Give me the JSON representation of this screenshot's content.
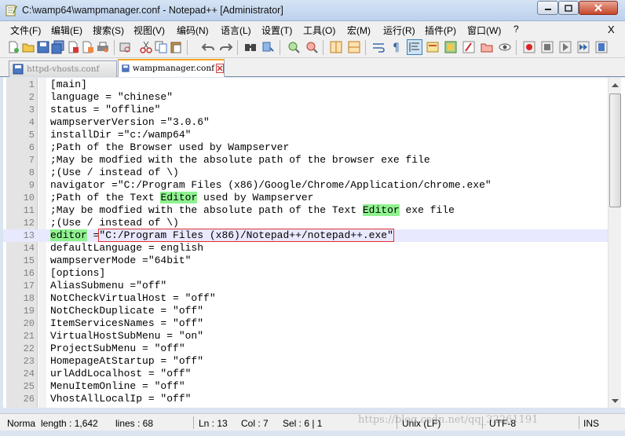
{
  "window": {
    "title": "C:\\wamp64\\wampmanager.conf - Notepad++ [Administrator]"
  },
  "menu": {
    "items": [
      "文件(F)",
      "编辑(E)",
      "搜索(S)",
      "视图(V)",
      "编码(N)",
      "语言(L)",
      "设置(T)",
      "工具(O)",
      "宏(M)",
      "运行(R)",
      "插件(P)",
      "窗口(W)",
      "?"
    ],
    "close_label": "X"
  },
  "tabs": [
    {
      "label": "httpd-vhosts.conf",
      "active": false
    },
    {
      "label": "wampmanager.conf",
      "active": true
    }
  ],
  "editor": {
    "lines": [
      {
        "n": "1",
        "text": "[main]"
      },
      {
        "n": "2",
        "text": "language = \"chinese\""
      },
      {
        "n": "3",
        "text": "status = \"offline\""
      },
      {
        "n": "4",
        "text": "wampserverVersion =\"3.0.6\""
      },
      {
        "n": "5",
        "text": "installDir =\"c:/wamp64\""
      },
      {
        "n": "6",
        "text": ";Path of the Browser used by Wampserver"
      },
      {
        "n": "7",
        "text": ";May be modfied with the absolute path of the browser exe file"
      },
      {
        "n": "8",
        "text": ";(Use / instead of \\)"
      },
      {
        "n": "9",
        "text": "navigator =\"C:/Program Files (x86)/Google/Chrome/Application/chrome.exe\""
      },
      {
        "n": "10",
        "pre": ";Path of the Text ",
        "hl": "Editor",
        "post": " used by Wampserver"
      },
      {
        "n": "11",
        "pre": ";May be modfied with the absolute path of the Text ",
        "hl": "Editor",
        "post": " exe file"
      },
      {
        "n": "12",
        "text": ";(Use / instead of \\)"
      },
      {
        "n": "13",
        "hl": "editor",
        "mid": " =",
        "boxed": "\"C:/Program Files (x86)/Notepad++/notepad++.exe\"",
        "current": true
      },
      {
        "n": "14",
        "text": "defaultLanguage = english"
      },
      {
        "n": "15",
        "text": "wampserverMode =\"64bit\""
      },
      {
        "n": "16",
        "text": "[options]"
      },
      {
        "n": "17",
        "text": "AliasSubmenu =\"off\""
      },
      {
        "n": "18",
        "text": "NotCheckVirtualHost = \"off\""
      },
      {
        "n": "19",
        "text": "NotCheckDuplicate = \"off\""
      },
      {
        "n": "20",
        "text": "ItemServicesNames = \"off\""
      },
      {
        "n": "21",
        "text": "VirtualHostSubMenu = \"on\""
      },
      {
        "n": "22",
        "text": "ProjectSubMenu = \"off\""
      },
      {
        "n": "23",
        "text": "HomepageAtStartup = \"off\""
      },
      {
        "n": "24",
        "text": "urlAddLocalhost = \"off\""
      },
      {
        "n": "25",
        "text": "MenuItemOnline = \"off\""
      },
      {
        "n": "26",
        "text": "VhostAllLocalIp = \"off\""
      }
    ]
  },
  "status": {
    "file_type": "Norma",
    "length": "length : 1,642",
    "lines": "lines : 68",
    "ln": "Ln : 13",
    "col": "Col : 7",
    "sel": "Sel : 6 | 1",
    "eol": "Unix (LF)",
    "encoding": "UTF-8",
    "mode": "INS"
  },
  "watermark": "https://blog.csdn.net/qq_32261191",
  "colors": {
    "highlight_green": "#8ff28f",
    "current_line": "#e8e8ff",
    "box_red": "#e03030",
    "tab_accent": "#f5a623"
  },
  "toolbar_icons": [
    "new-file-icon",
    "open-file-icon",
    "save-icon",
    "save-all-icon",
    "close-icon",
    "close-all-icon",
    "print-icon",
    "cut-icon",
    "copy-icon",
    "paste-icon",
    "undo-icon",
    "redo-icon",
    "find-icon",
    "replace-icon",
    "zoom-in-icon",
    "zoom-out-icon",
    "sync-vertical-icon",
    "sync-horizontal-icon",
    "word-wrap-icon",
    "show-all-chars-icon",
    "indent-guide-icon",
    "udl-icon",
    "doc-map-icon",
    "function-list-icon",
    "folder-workspace-icon",
    "monitor-icon",
    "record-macro-icon",
    "stop-macro-icon",
    "play-macro-icon",
    "run-macro-multiple-icon",
    "save-macro-icon"
  ]
}
